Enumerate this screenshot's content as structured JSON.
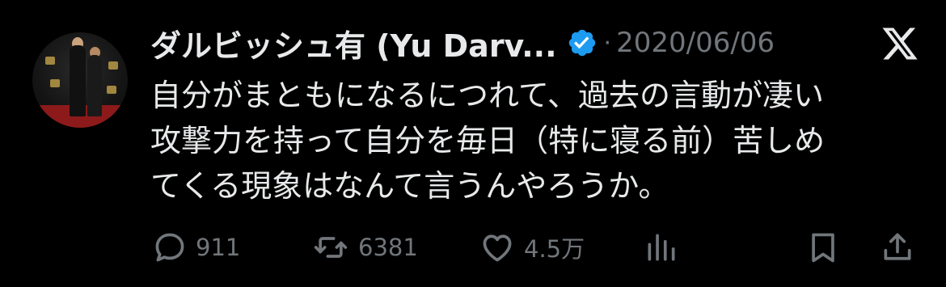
{
  "tweet": {
    "author_name": "ダルビッシュ有 (Yu Darv...",
    "separator": "·",
    "date": "2020/06/06",
    "text_lines": [
      "自分がまともになるにつれて、過去の言動が凄い",
      "攻撃力を持って自分を毎日（特に寝る前）苦しめ",
      "てくる現象はなんて言うんやろうか。"
    ]
  },
  "actions": {
    "replies": "911",
    "reposts": "6381",
    "likes": "4.5万"
  },
  "icons": {
    "verified": "verified-badge-icon",
    "brand": "x-logo-icon",
    "reply": "speech-bubble-icon",
    "repost": "repost-arrows-icon",
    "like": "heart-icon",
    "views": "bar-chart-icon",
    "bookmark": "bookmark-icon",
    "share": "share-upload-icon"
  },
  "colors": {
    "background": "#000000",
    "text": "#e7e9ea",
    "muted": "#71767b",
    "verified": "#1d9bf0"
  }
}
